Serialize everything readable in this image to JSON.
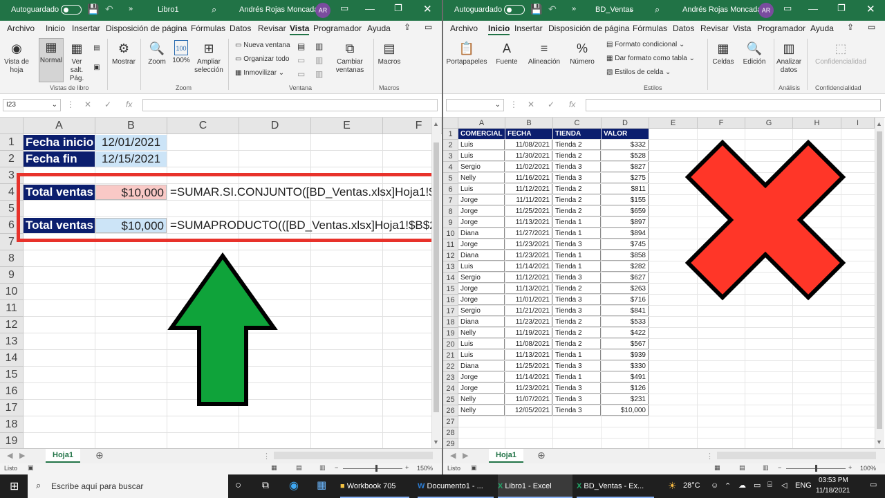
{
  "left": {
    "title": {
      "autosave": "Autoguardado",
      "file": "Libro1",
      "user": "Andrés Rojas Moncada",
      "initials": "AR"
    },
    "tabs": [
      "Archivo",
      "Inicio",
      "Insertar",
      "Disposición de página",
      "Fórmulas",
      "Datos",
      "Revisar",
      "Vista",
      "Programador",
      "Ayuda"
    ],
    "ribbon": {
      "vista_hoja": "Vista de hoja",
      "normal": "Normal",
      "ver_salt": "Ver salt. Pág.",
      "mostrar": "Mostrar",
      "zoom": "Zoom",
      "zoom100": "100%",
      "ampliar": "Ampliar selección",
      "nueva_ventana": "Nueva ventana",
      "organizar": "Organizar todo",
      "inmovilizar": "Inmovilizar",
      "cambiar": "Cambiar ventanas",
      "macros": "Macros",
      "g_vistas": "Vistas de libro",
      "g_zoom": "Zoom",
      "g_ventana": "Ventana",
      "g_macros": "Macros",
      "n100": "100"
    },
    "namebox": "I23",
    "cols": [
      "A",
      "B",
      "C",
      "D",
      "E",
      "F"
    ],
    "rows": [
      "1",
      "2",
      "3",
      "4",
      "5",
      "6",
      "7",
      "8",
      "9",
      "10",
      "11",
      "12",
      "13",
      "14",
      "15",
      "16",
      "17",
      "18",
      "19"
    ],
    "cells": {
      "a1": "Fecha inicio",
      "b1": "12/01/2021",
      "a2": "Fecha fin",
      "b2": "12/15/2021",
      "a4": "Total ventas",
      "b4": "$10,000",
      "c4": "=SUMAR.SI.CONJUNTO([BD_Ventas.xlsx]Hoja1!$D",
      "a6": "Total ventas",
      "b6": "$10,000",
      "c6": "=SUMAPRODUCTO(([BD_Ventas.xlsx]Hoja1!$B$2:$"
    },
    "sheet": "Hoja1",
    "status": "Listo",
    "zoom_pct": "150%"
  },
  "right": {
    "title": {
      "autosave": "Autoguardado",
      "file": "BD_Ventas",
      "user": "Andrés Rojas Moncada",
      "initials": "AR"
    },
    "tabs": [
      "Archivo",
      "Inicio",
      "Insertar",
      "Disposición de página",
      "Fórmulas",
      "Datos",
      "Revisar",
      "Vista",
      "Programador",
      "Ayuda"
    ],
    "ribbon": {
      "portapapeles": "Portapapeles",
      "fuente": "Fuente",
      "alineacion": "Alineación",
      "numero": "Número",
      "formato_cond": "Formato condicional",
      "dar_formato": "Dar formato como tabla",
      "estilos_celda": "Estilos de celda",
      "celdas": "Celdas",
      "edicion": "Edición",
      "analizar": "Analizar datos",
      "confidencialidad": "Confidencialidad",
      "g_estilos": "Estilos",
      "g_analisis": "Análisis",
      "g_conf": "Confidencialidad"
    },
    "cols": [
      "A",
      "B",
      "C",
      "D",
      "E",
      "F",
      "G",
      "H",
      "I"
    ],
    "headers": [
      "COMERCIAL",
      "FECHA",
      "TIENDA",
      "VALOR"
    ],
    "data": [
      [
        "Luis",
        "11/08/2021",
        "Tienda 2",
        "$332"
      ],
      [
        "Luis",
        "11/30/2021",
        "Tienda 2",
        "$528"
      ],
      [
        "Sergio",
        "11/02/2021",
        "Tienda 3",
        "$827"
      ],
      [
        "Nelly",
        "11/16/2021",
        "Tienda 3",
        "$275"
      ],
      [
        "Luis",
        "11/12/2021",
        "Tienda 2",
        "$811"
      ],
      [
        "Jorge",
        "11/11/2021",
        "Tienda 2",
        "$155"
      ],
      [
        "Jorge",
        "11/25/2021",
        "Tienda 2",
        "$659"
      ],
      [
        "Jorge",
        "11/13/2021",
        "Tienda 1",
        "$897"
      ],
      [
        "Diana",
        "11/27/2021",
        "Tienda 1",
        "$894"
      ],
      [
        "Jorge",
        "11/23/2021",
        "Tienda 3",
        "$745"
      ],
      [
        "Diana",
        "11/23/2021",
        "Tienda 1",
        "$858"
      ],
      [
        "Luis",
        "11/14/2021",
        "Tienda 1",
        "$282"
      ],
      [
        "Sergio",
        "11/12/2021",
        "Tienda 3",
        "$627"
      ],
      [
        "Jorge",
        "11/13/2021",
        "Tienda 2",
        "$263"
      ],
      [
        "Jorge",
        "11/01/2021",
        "Tienda 3",
        "$716"
      ],
      [
        "Sergio",
        "11/21/2021",
        "Tienda 3",
        "$841"
      ],
      [
        "Diana",
        "11/23/2021",
        "Tienda 2",
        "$533"
      ],
      [
        "Nelly",
        "11/19/2021",
        "Tienda 2",
        "$422"
      ],
      [
        "Luis",
        "11/08/2021",
        "Tienda 2",
        "$567"
      ],
      [
        "Luis",
        "11/13/2021",
        "Tienda 1",
        "$939"
      ],
      [
        "Diana",
        "11/25/2021",
        "Tienda 3",
        "$330"
      ],
      [
        "Jorge",
        "11/14/2021",
        "Tienda 1",
        "$491"
      ],
      [
        "Jorge",
        "11/23/2021",
        "Tienda 3",
        "$126"
      ],
      [
        "Nelly",
        "11/07/2021",
        "Tienda 3",
        "$231"
      ],
      [
        "Nelly",
        "12/05/2021",
        "Tienda 3",
        "$10,000"
      ]
    ],
    "rows": [
      "1",
      "2",
      "3",
      "4",
      "5",
      "6",
      "7",
      "8",
      "9",
      "10",
      "11",
      "12",
      "13",
      "14",
      "15",
      "16",
      "17",
      "18",
      "19",
      "20",
      "21",
      "22",
      "23",
      "24",
      "25",
      "26",
      "27",
      "28",
      "29"
    ],
    "sheet": "Hoja1",
    "status": "Listo",
    "zoom_pct": "100%"
  },
  "taskbar": {
    "search": "Escribe aquí para buscar",
    "apps": [
      "Workbook 705",
      "Documento1 - ...",
      "Libro1 - Excel",
      "BD_Ventas - Ex..."
    ],
    "temp": "28°C",
    "lang": "ENG",
    "time": "03:53 PM",
    "date": "11/18/2021"
  },
  "colors": {
    "excel_green": "#217346",
    "navy": "#0b1e6e",
    "pink": "#f9c9c6",
    "lightblue": "#cce4f7",
    "red_frame": "#e8322b",
    "arrow_green": "#0fa33a",
    "x_red": "#ff3628"
  }
}
